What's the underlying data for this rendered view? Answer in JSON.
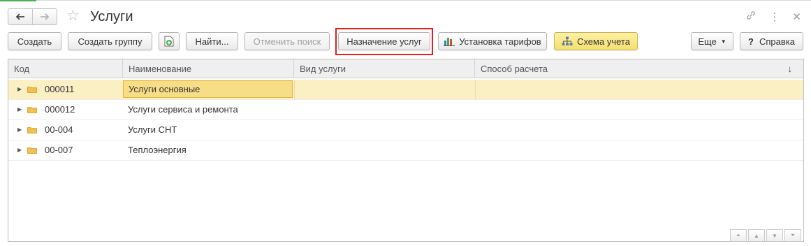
{
  "window": {
    "title": "Услуги",
    "accent_color": "#4caf50"
  },
  "nav": {
    "back_icon": "arrow-left-icon",
    "forward_icon": "arrow-right-icon",
    "back_glyph": "🡐",
    "forward_glyph": "🡒"
  },
  "toolbar": {
    "create": "Создать",
    "create_group": "Создать группу",
    "find": "Найти...",
    "cancel_search": "Отменить поиск",
    "assign_services": "Назначение услуг",
    "set_tariffs": "Установка тарифов",
    "accounting_scheme": "Схема учета",
    "more": "Еще",
    "help": "Справка",
    "help_prefix": "?"
  },
  "table": {
    "columns": [
      "Код",
      "Наименование",
      "Вид услуги",
      "Способ расчета"
    ],
    "rows": [
      {
        "code": "000011",
        "name": "Услуги основные",
        "type": "",
        "method": ""
      },
      {
        "code": "000012",
        "name": "Услуги сервиса и ремонта",
        "type": "",
        "method": ""
      },
      {
        "code": "00-004",
        "name": "Услуги СНТ",
        "type": "",
        "method": ""
      },
      {
        "code": "00-007",
        "name": "Теплоэнергия",
        "type": "",
        "method": ""
      }
    ],
    "selected_row": 0
  },
  "colors": {
    "selected_row": "#fbefc4",
    "focus_cell": "#f7dd86",
    "highlight_frame": "#e0201f",
    "folder": "#f2c14e"
  }
}
